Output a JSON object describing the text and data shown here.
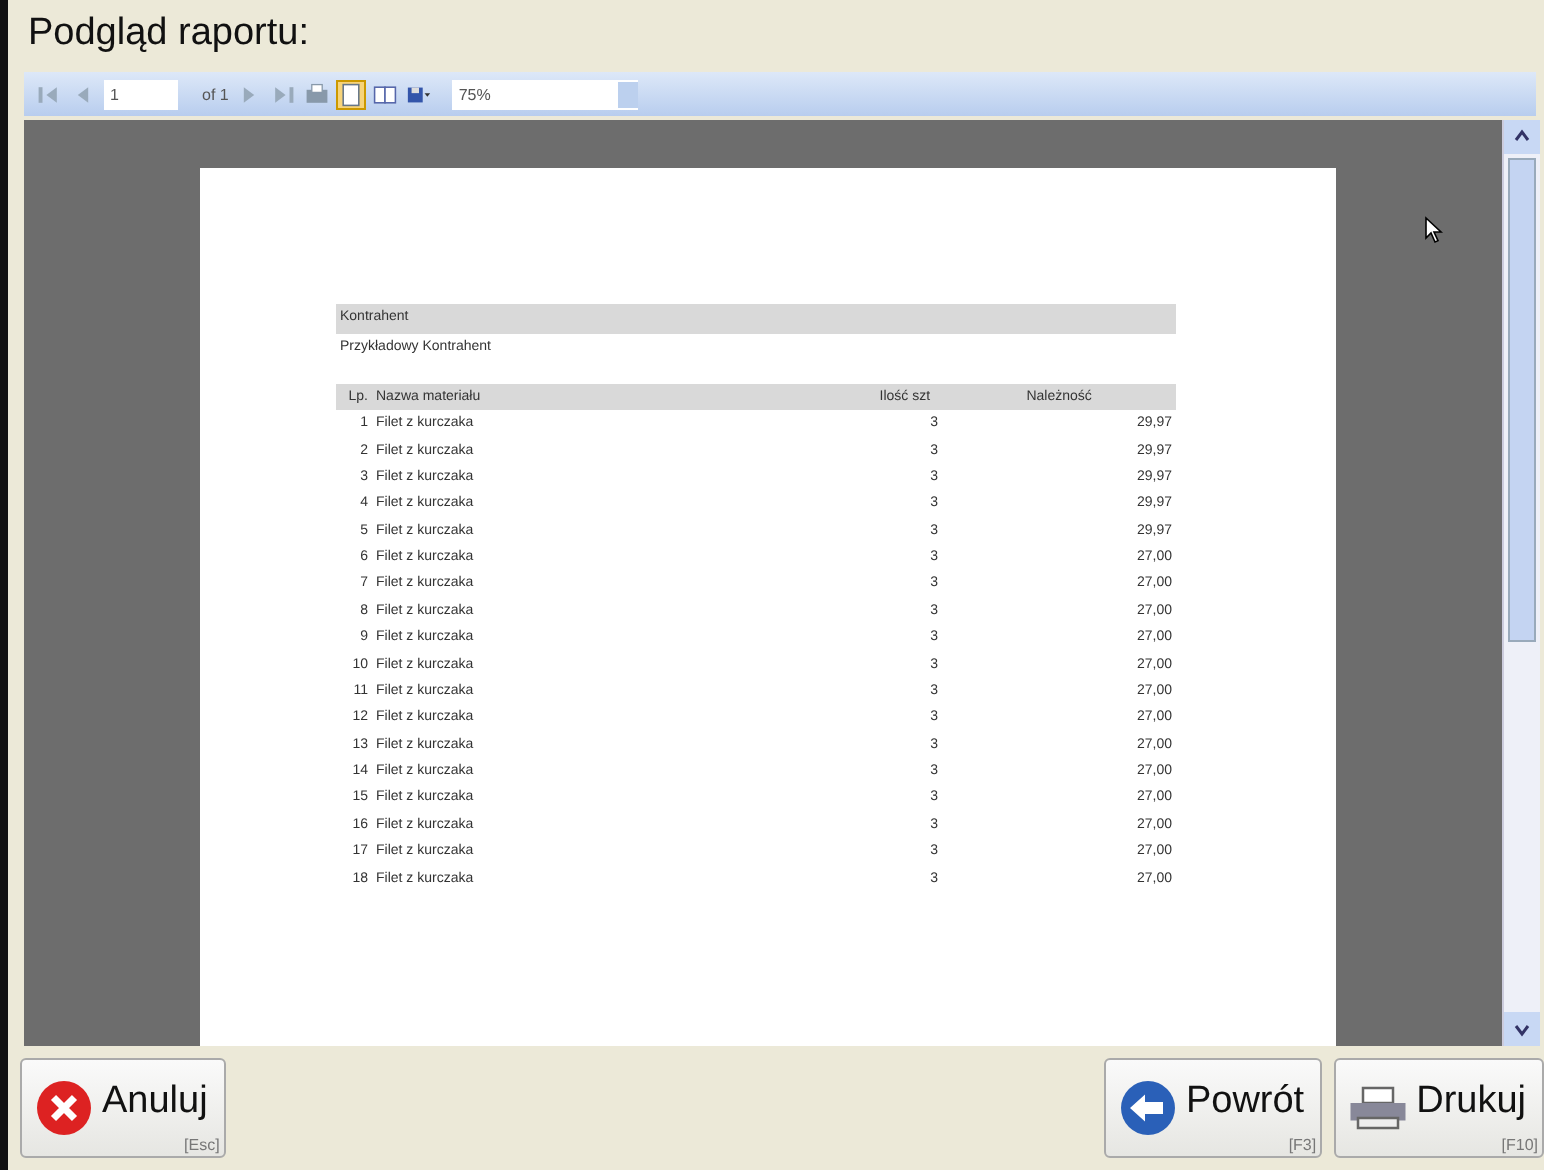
{
  "window": {
    "title": "Podgląd raportu:"
  },
  "toolbar": {
    "page": "1",
    "page_count": "of 1",
    "zoom": "75%"
  },
  "report": {
    "section_label": "Kontrahent",
    "customer": "Przykładowy Kontrahent",
    "columns": [
      "Lp.",
      "Nazwa materiału",
      "Ilość szt",
      "Należność"
    ],
    "rows": [
      [
        "1",
        "Filet z kurczaka",
        "3",
        "29,97"
      ],
      [
        "2",
        "Filet z kurczaka",
        "3",
        "29,97"
      ],
      [
        "3",
        "Filet z kurczaka",
        "3",
        "29,97"
      ],
      [
        "4",
        "Filet z kurczaka",
        "3",
        "29,97"
      ],
      [
        "5",
        "Filet z kurczaka",
        "3",
        "29,97"
      ],
      [
        "6",
        "Filet z kurczaka",
        "3",
        "27,00"
      ],
      [
        "7",
        "Filet z kurczaka",
        "3",
        "27,00"
      ],
      [
        "8",
        "Filet z kurczaka",
        "3",
        "27,00"
      ],
      [
        "9",
        "Filet z kurczaka",
        "3",
        "27,00"
      ],
      [
        "10",
        "Filet z kurczaka",
        "3",
        "27,00"
      ],
      [
        "11",
        "Filet z kurczaka",
        "3",
        "27,00"
      ],
      [
        "12",
        "Filet z kurczaka",
        "3",
        "27,00"
      ],
      [
        "13",
        "Filet z kurczaka",
        "3",
        "27,00"
      ],
      [
        "14",
        "Filet z kurczaka",
        "3",
        "27,00"
      ],
      [
        "15",
        "Filet z kurczaka",
        "3",
        "27,00"
      ],
      [
        "16",
        "Filet z kurczaka",
        "3",
        "27,00"
      ],
      [
        "17",
        "Filet z kurczaka",
        "3",
        "27,00"
      ],
      [
        "18",
        "Filet z kurczaka",
        "3",
        "27,00"
      ]
    ]
  },
  "buttons": [
    {
      "kind": "cancel",
      "label": "Anuluj",
      "shortcut": "[Esc]"
    },
    {
      "kind": "back",
      "label": "Powrót",
      "shortcut": "[F3]"
    },
    {
      "kind": "print",
      "label": "Drukuj",
      "shortcut": "[F10]"
    }
  ]
}
